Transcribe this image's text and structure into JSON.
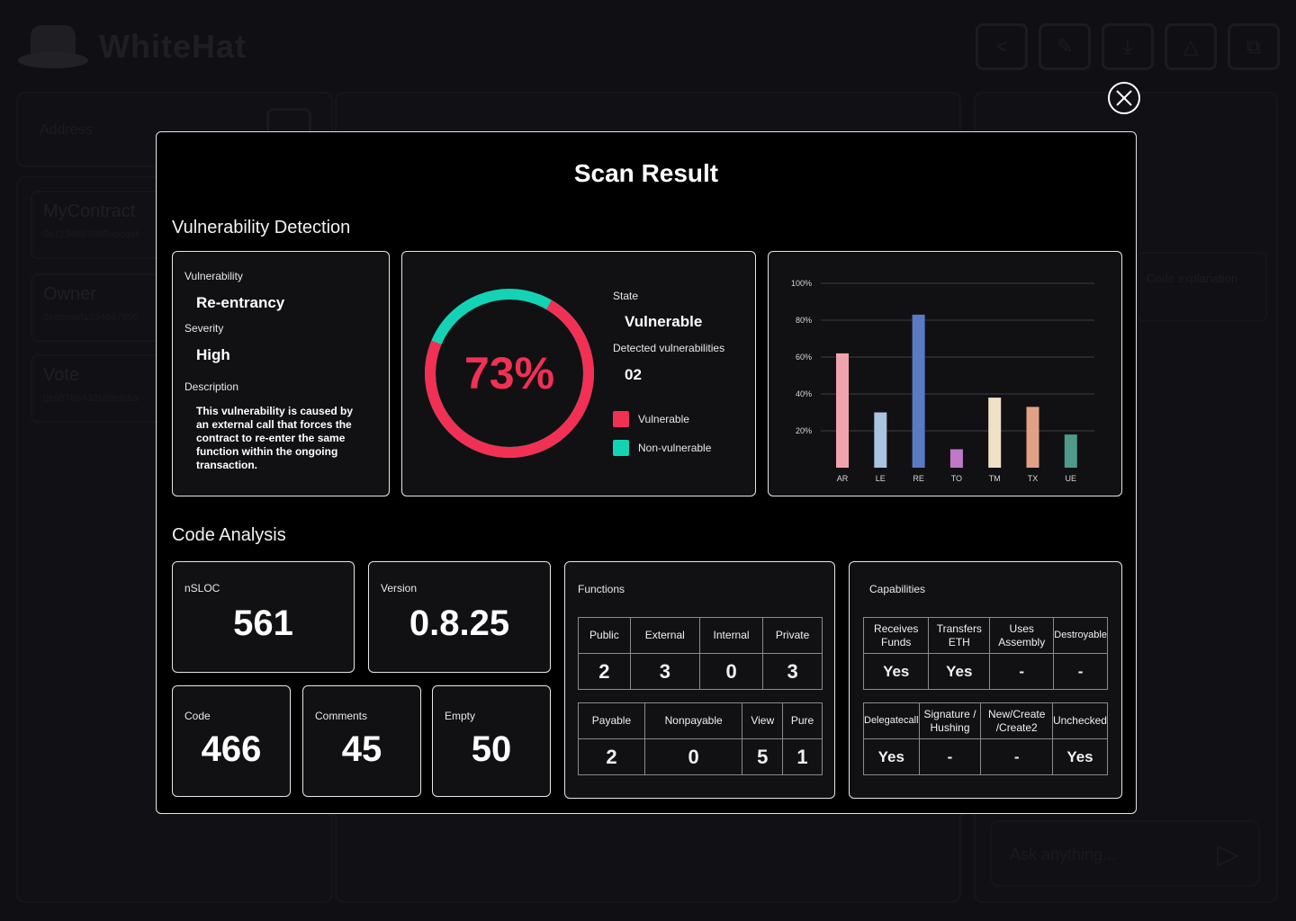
{
  "background": {
    "brand": "WhiteHat",
    "address_placeholder": "Address",
    "contracts": [
      {
        "name": "MyContract",
        "sub": "0x1234567890abcdef"
      },
      {
        "name": "Owner",
        "sub": "0xabcdef1234567890"
      },
      {
        "name": "Vote",
        "sub": "0x9876543210fedcba"
      }
    ],
    "code_explanation": "Code explanation",
    "chat_placeholder": "Ask anything..."
  },
  "modal": {
    "title": "Scan Result",
    "vuln_section": "Vulnerability Detection",
    "code_section": "Code Analysis",
    "vulnerability_label": "Vulnerability",
    "vulnerability": "Re-entrancy",
    "severity_label": "Severity",
    "severity": "High",
    "description_label": "Description",
    "description": "This vulnerability is caused by an external call that forces the contract to re-enter the same function within the ongoing transaction.",
    "percent": "73%",
    "percent_value": 73,
    "state_label": "State",
    "state": "Vulnerable",
    "detected_label": "Detected vulnerabilities",
    "detected": "02",
    "legend_vulnerable": "Vulnerable",
    "legend_nonvulnerable": "Non-vulnerable",
    "colors": {
      "vulnerable": "#f23054",
      "nonvulnerable": "#14d3b5"
    }
  },
  "chart_data": {
    "type": "bar",
    "categories": [
      "AR",
      "LE",
      "RE",
      "TO",
      "TM",
      "TX",
      "UE"
    ],
    "values": [
      62,
      30,
      83,
      10,
      38,
      33,
      18
    ],
    "colors": [
      "#f1a3ac",
      "#a9c4df",
      "#5b7ac4",
      "#c278c8",
      "#efe1c6",
      "#e2a186",
      "#4f9a8a"
    ],
    "yticks": [
      "20%",
      "40%",
      "60%",
      "80%",
      "100%"
    ],
    "ylim": [
      0,
      100
    ],
    "grid": true
  },
  "code": {
    "nsloc_label": "nSLOC",
    "nsloc": "561",
    "version_label": "Version",
    "version": "0.8.25",
    "code_label": "Code",
    "code": "466",
    "comments_label": "Comments",
    "comments": "45",
    "empty_label": "Empty",
    "empty": "50",
    "functions_label": "Functions",
    "functions_top": {
      "headers": [
        "Public",
        "External",
        "Internal",
        "Private"
      ],
      "values": [
        "2",
        "3",
        "0",
        "3"
      ]
    },
    "functions_bottom": {
      "headers": [
        "Payable",
        "Nonpayable",
        "View",
        "Pure"
      ],
      "values": [
        "2",
        "0",
        "5",
        "1"
      ]
    },
    "capabilities_label": "Capabilities",
    "caps_top": {
      "headers": [
        "Receives Funds",
        "Transfers ETH",
        "Uses Assembly",
        "Destroyable"
      ],
      "values": [
        "Yes",
        "Yes",
        "-",
        "-"
      ]
    },
    "caps_bottom": {
      "headers": [
        "Delegatecall",
        "Signature / Hushing",
        "New/Create /Create2",
        "Unchecked"
      ],
      "values": [
        "Yes",
        "-",
        "-",
        "Yes"
      ]
    }
  }
}
